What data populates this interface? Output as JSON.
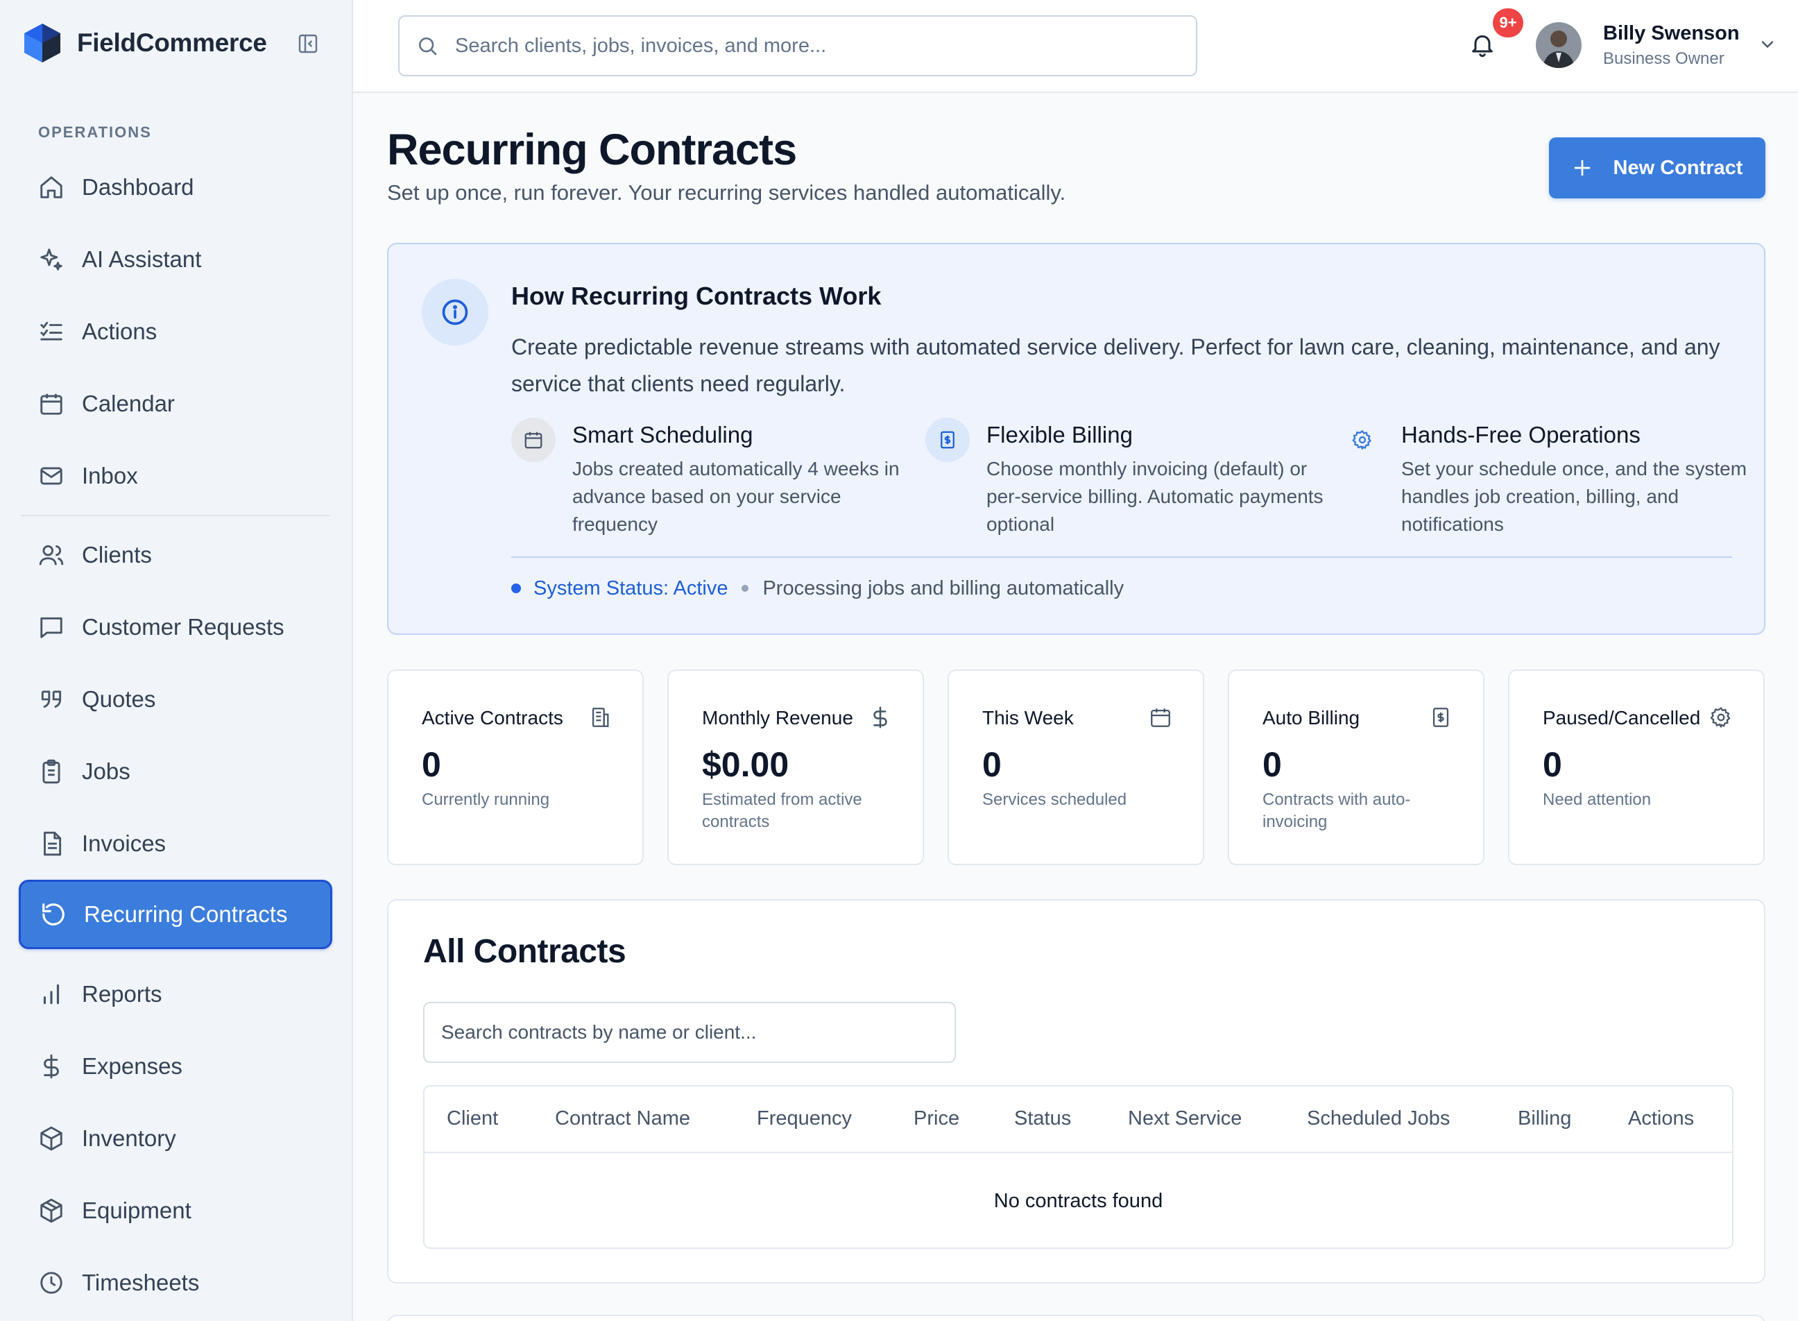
{
  "app": {
    "name": "FieldCommerce"
  },
  "sidebar": {
    "section_label": "OPERATIONS",
    "items": [
      {
        "label": "Dashboard",
        "icon": "home-icon"
      },
      {
        "label": "AI Assistant",
        "icon": "sparkles-icon"
      },
      {
        "label": "Actions",
        "icon": "list-checks-icon"
      },
      {
        "label": "Calendar",
        "icon": "calendar-icon"
      },
      {
        "label": "Inbox",
        "icon": "mail-icon"
      },
      {
        "label": "Clients",
        "icon": "users-icon"
      },
      {
        "label": "Customer Requests",
        "icon": "message-square-icon"
      },
      {
        "label": "Quotes",
        "icon": "quote-icon"
      },
      {
        "label": "Jobs",
        "icon": "clipboard-icon"
      },
      {
        "label": "Invoices",
        "icon": "file-text-icon"
      },
      {
        "label": "Recurring Contracts",
        "icon": "rotate-ccw-icon",
        "active": true
      },
      {
        "label": "Reports",
        "icon": "bar-chart-icon"
      },
      {
        "label": "Expenses",
        "icon": "dollar-icon"
      },
      {
        "label": "Inventory",
        "icon": "package-icon"
      },
      {
        "label": "Equipment",
        "icon": "box-icon"
      },
      {
        "label": "Timesheets",
        "icon": "clock-icon"
      }
    ]
  },
  "topbar": {
    "search_placeholder": "Search clients, jobs, invoices, and more...",
    "notification_badge": "9+",
    "user": {
      "name": "Billy Swenson",
      "role": "Business Owner"
    }
  },
  "header": {
    "title": "Recurring Contracts",
    "subtitle": "Set up once, run forever. Your recurring services handled automatically.",
    "new_button": "New Contract"
  },
  "info": {
    "title": "How Recurring Contracts Work",
    "description": "Create predictable revenue streams with automated service delivery. Perfect for lawn care, cleaning, maintenance, and any service that clients need regularly.",
    "features": [
      {
        "title": "Smart Scheduling",
        "text": "Jobs created automatically 4 weeks in advance based on your service frequency",
        "icon": "calendar-icon"
      },
      {
        "title": "Flexible Billing",
        "text": "Choose monthly invoicing (default) or per-service billing. Automatic payments optional",
        "icon": "receipt-dollar-icon"
      },
      {
        "title": "Hands-Free Operations",
        "text": "Set your schedule once, and the system handles job creation, billing, and notifications",
        "icon": "gear-icon"
      }
    ],
    "status": "System Status: Active",
    "status_desc": "Processing jobs and billing automatically"
  },
  "stats": [
    {
      "label": "Active Contracts",
      "value": "0",
      "sub": "Currently running",
      "icon": "building-icon"
    },
    {
      "label": "Monthly Revenue",
      "value": "$0.00",
      "sub": "Estimated from active contracts",
      "icon": "dollar-icon"
    },
    {
      "label": "This Week",
      "value": "0",
      "sub": "Services scheduled",
      "icon": "calendar-icon"
    },
    {
      "label": "Auto Billing",
      "value": "0",
      "sub": "Contracts with auto-invoicing",
      "icon": "receipt-dollar-icon"
    },
    {
      "label": "Paused/Cancelled",
      "value": "0",
      "sub": "Need attention",
      "icon": "gear-icon"
    }
  ],
  "contracts": {
    "title": "All Contracts",
    "search_placeholder": "Search contracts by name or client...",
    "columns": [
      "Client",
      "Contract Name",
      "Frequency",
      "Price",
      "Status",
      "Next Service",
      "Scheduled Jobs",
      "Billing",
      "Actions"
    ],
    "empty_message": "No contracts found"
  },
  "colors": {
    "accent": "#3b7ddd",
    "badge": "#ef4444",
    "info_bg": "#eef3fd"
  }
}
